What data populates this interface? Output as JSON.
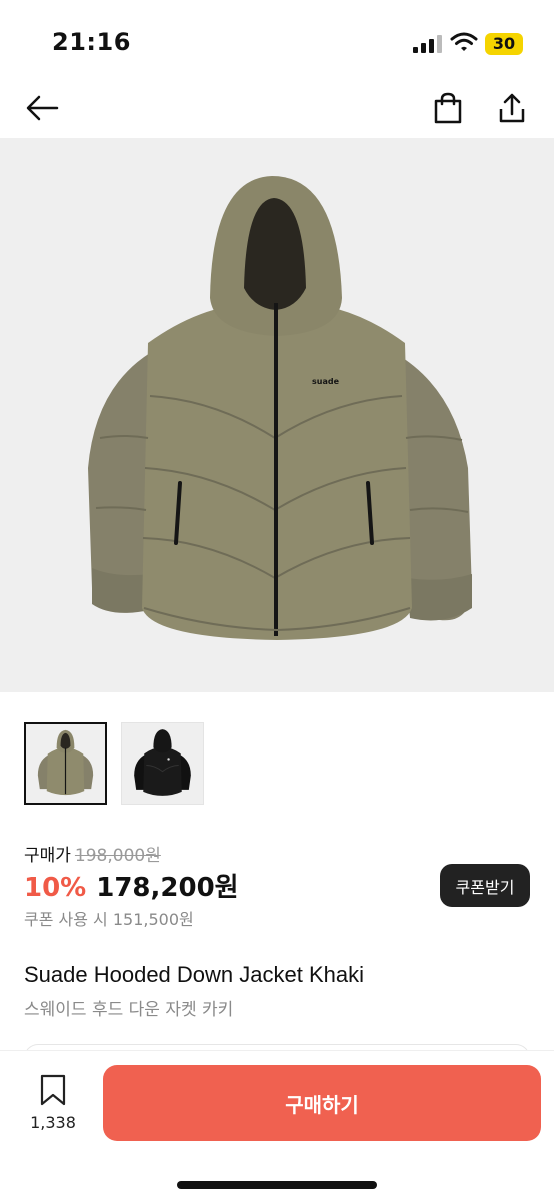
{
  "status_bar": {
    "time": "21:16",
    "battery": "30",
    "icons": [
      "signal-icon",
      "wifi-icon",
      "battery-icon"
    ]
  },
  "nav": {
    "icons": [
      "back-arrow-icon",
      "shopping-bag-icon",
      "share-icon"
    ]
  },
  "product": {
    "thumbnails": [
      {
        "name": "khaki-jacket",
        "selected": true
      },
      {
        "name": "black-jacket",
        "selected": false
      }
    ],
    "price_label": "구매가",
    "original_price": "198,000원",
    "discount": "10%",
    "sale_price": "178,200원",
    "coupon_button": "쿠폰받기",
    "coupon_price": "쿠폰 사용 시 151,500원",
    "name_en": "Suade Hooded Down Jacket Khaki",
    "name_ko": "스웨이드 후드 다운 자켓 카키",
    "logo_text": "suade"
  },
  "bottom_bar": {
    "bookmark_count": "1,338",
    "buy_button": "구매하기"
  },
  "colors": {
    "accent": "#f06150",
    "discount": "#f05a47",
    "jacket_khaki": "#8f8b6d",
    "jacket_black": "#1a1a1a",
    "battery": "#f5d400"
  }
}
